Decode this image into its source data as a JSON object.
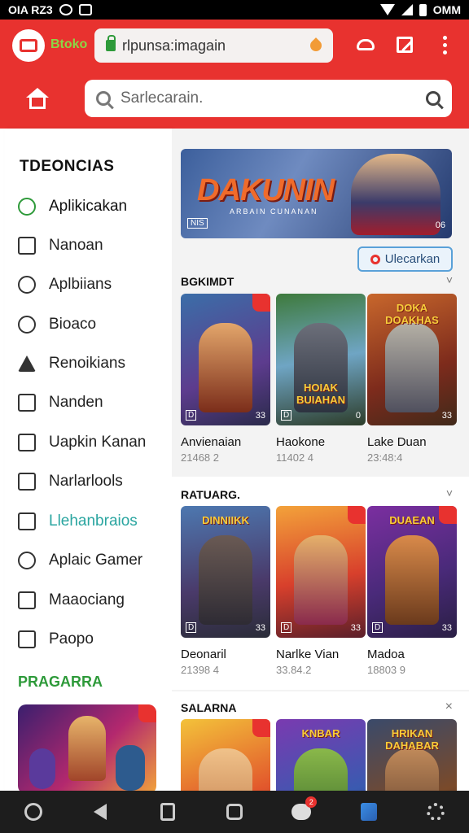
{
  "status_bar": {
    "time": "OIA RZ3",
    "right_text": "OMM"
  },
  "browser": {
    "brand_name": "Btoko",
    "url": "rlpunsa:imagain"
  },
  "search": {
    "placeholder": "Sarlecarain."
  },
  "sidebar": {
    "title": "TDEONCIAS",
    "items": [
      {
        "label": "Aplikicakan",
        "icon": "search-icon"
      },
      {
        "label": "Nanoan",
        "icon": "square-icon"
      },
      {
        "label": "Aplbiians",
        "icon": "search-icon"
      },
      {
        "label": "Bioaco",
        "icon": "target-icon"
      },
      {
        "label": "Renoikians",
        "icon": "triangle-icon"
      },
      {
        "label": "Nanden",
        "icon": "check-box-icon"
      },
      {
        "label": "Uapkin Kanan",
        "icon": "shield-icon"
      },
      {
        "label": "Narlarlools",
        "icon": "check-box-icon"
      },
      {
        "label": "Llehanbraios",
        "icon": "square-icon"
      },
      {
        "label": "Aplaic Gamer",
        "icon": "gamepad-icon"
      },
      {
        "label": "Maaociang",
        "icon": "book-icon"
      },
      {
        "label": "Paopo",
        "icon": "grid-icon"
      }
    ],
    "section_label": "PRAGARRA"
  },
  "content": {
    "banner": {
      "title": "DAKUNIN",
      "subtitle": "ARBAIN CUNANAN",
      "tag": "NIS",
      "count": "06"
    },
    "discover_label": "Ulecarkan",
    "sections": [
      {
        "title": "BGKIMDT",
        "more": "˅",
        "cards": [
          {
            "art_text": "",
            "title": "Anvienaian",
            "meta": "21468 2",
            "badge_left": "D",
            "badge_right": "33"
          },
          {
            "art_text": "HOIAK BUIAHAN",
            "title": "Haokone",
            "meta": "11402 4",
            "badge_left": "D",
            "badge_right": "0"
          },
          {
            "art_text": "DOKA DOAKHAS",
            "title": "Lake Duan",
            "meta": "23:48:4",
            "badge_left": "",
            "badge_right": "33"
          }
        ]
      },
      {
        "title": "RATUARG.",
        "more": "˅",
        "cards": [
          {
            "art_text": "DINNIIKK",
            "title": "Deonaril",
            "meta": "21398 4",
            "badge_left": "D",
            "badge_right": "33"
          },
          {
            "art_text": "",
            "title": "Narlke Vian",
            "meta": "33.84.2",
            "badge_left": "D",
            "badge_right": "33"
          },
          {
            "art_text": "DUAEAN",
            "title": "Madoa",
            "meta": "18803 9",
            "badge_left": "D",
            "badge_right": "33"
          }
        ]
      },
      {
        "title": "SALARNA",
        "more": "×",
        "cards": [
          {
            "art_text": "",
            "title": "",
            "meta": "",
            "badge_left": "",
            "badge_right": ""
          },
          {
            "art_text": "KNBAR",
            "title": "",
            "meta": "",
            "badge_left": "",
            "badge_right": ""
          },
          {
            "art_text": "HRIKAN DAHABAR",
            "title": "",
            "meta": "",
            "badge_left": "",
            "badge_right": ""
          }
        ]
      }
    ]
  },
  "nav": {
    "notification_count": "2"
  },
  "colors": {
    "brand_red": "#e8322f",
    "brand_green": "#8bd645",
    "accent_teal": "#2aa5a0",
    "nav_dark": "#1d1d1d"
  }
}
